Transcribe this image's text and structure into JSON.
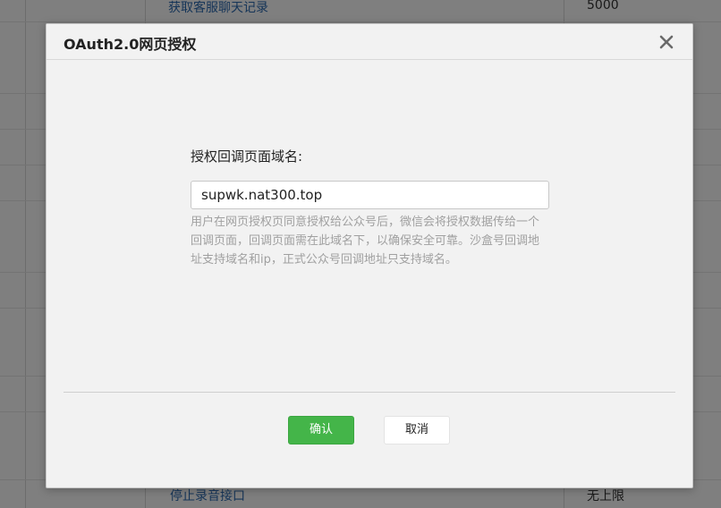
{
  "background": {
    "rows": [
      {
        "link": "获取客服聊天记录",
        "value": "5000"
      },
      {
        "link": "停止录音接口",
        "value": "无上限"
      }
    ]
  },
  "dialog": {
    "title": "OAuth2.0网页授权",
    "close_icon": "close-icon",
    "field_label": "授权回调页面域名:",
    "domain_value": "supwk.nat300.top",
    "help_text": "用户在网页授权页同意授权给公众号后，微信会将授权数据传给一个回调页面，回调页面需在此域名下，以确保安全可靠。沙盒号回调地址支持域名和ip，正式公众号回调地址只支持域名。",
    "confirm_label": "确认",
    "cancel_label": "取消"
  },
  "colors": {
    "confirm_button": "#44b549",
    "link": "#2d6ab1",
    "overlay": "rgba(0,0,0,0.5)"
  }
}
